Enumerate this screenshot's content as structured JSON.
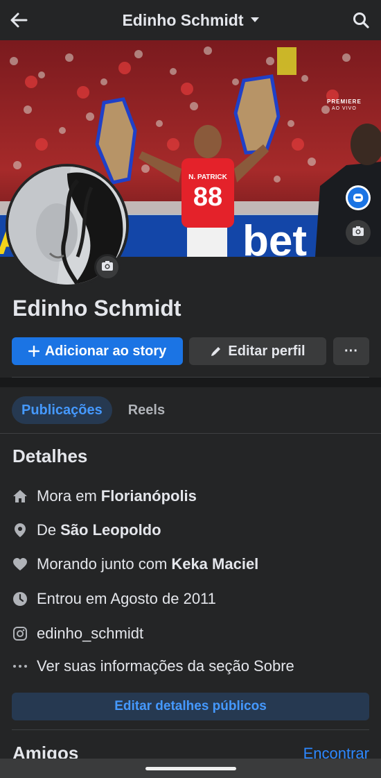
{
  "header": {
    "title": "Edinho Schmidt",
    "back_icon": "arrow-left-icon",
    "dropdown_icon": "caret-down-icon",
    "search_icon": "search-icon"
  },
  "cover": {
    "badge_brand": "PREMIERE",
    "badge_live": "AO VIVO",
    "jersey_name": "N. PATRICK",
    "jersey_number": "88",
    "banner_left": "AL",
    "banner_right": "bet"
  },
  "profile": {
    "name": "Edinho Schmidt"
  },
  "actions": {
    "add_story": "Adicionar ao story",
    "edit_profile": "Editar perfil",
    "more": "···"
  },
  "tabs": [
    {
      "label": "Publicações",
      "active": true
    },
    {
      "label": "Reels",
      "active": false
    }
  ],
  "details": {
    "title": "Detalhes",
    "items": [
      {
        "icon": "home-icon",
        "prefix": "Mora em",
        "value": "Florianópolis"
      },
      {
        "icon": "location-pin-icon",
        "prefix": "De",
        "value": "São Leopoldo"
      },
      {
        "icon": "heart-icon",
        "prefix": "Morando junto com",
        "value": "Keka Maciel"
      },
      {
        "icon": "clock-icon",
        "prefix": "Entrou em Agosto de 2011",
        "value": ""
      },
      {
        "icon": "instagram-icon",
        "prefix": "edinho_schmidt",
        "value": ""
      },
      {
        "icon": "ellipsis-icon",
        "prefix": "Ver suas informações da seção Sobre",
        "value": ""
      }
    ],
    "edit_button": "Editar detalhes públicos"
  },
  "friends": {
    "title": "Amigos",
    "find": "Encontrar"
  },
  "colors": {
    "background": "#242526",
    "accent": "#1b74e4",
    "accent_text": "#4599ff",
    "secondary_button": "#3a3b3c"
  }
}
